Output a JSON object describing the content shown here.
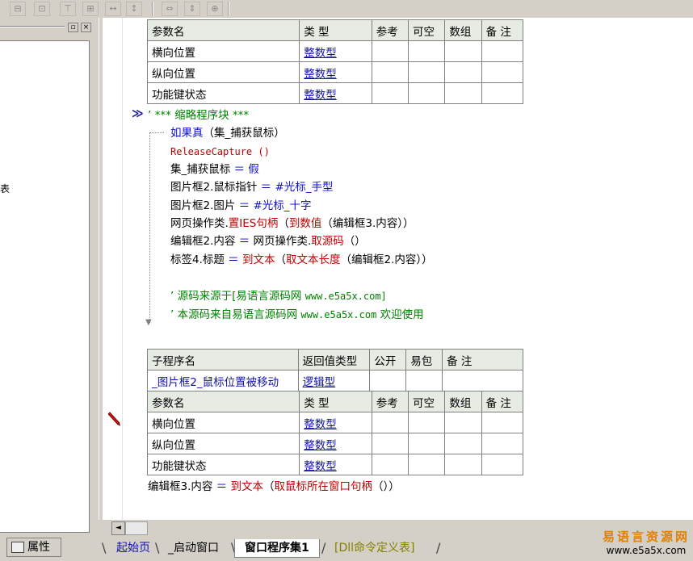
{
  "toolbar": {
    "buttons": [
      "align-left-icon",
      "align-center-icon",
      "align-top-icon",
      "align-middle-icon",
      "space-horizontal-icon",
      "space-vertical-icon",
      "same-width-icon",
      "same-height-icon",
      "same-size-icon"
    ]
  },
  "left_panel": {
    "fragment": "表",
    "min_btn": "▫",
    "close_btn": "×"
  },
  "table1": {
    "header": [
      "参数名",
      "类 型",
      "参考",
      "可空",
      "数组",
      "备 注"
    ],
    "rows": [
      {
        "name": "横向位置",
        "type": "整数型"
      },
      {
        "name": "纵向位置",
        "type": "整数型"
      },
      {
        "name": "功能键状态",
        "type": "整数型"
      }
    ]
  },
  "code": {
    "block_comment": "’ *** 缩略程序块 ***",
    "line1_kw": "如果真",
    "line1_rest": "（集_捕获鼠标）",
    "line2": "ReleaseCapture ()",
    "line3_a": "集_捕获鼠标",
    "line3_b": " ＝ ",
    "line3_c": "假",
    "line4_a": "图片框2.鼠标指针",
    "line4_b": " ＝ ",
    "line4_c": "#光标_手型",
    "line5_a": "图片框2.图片",
    "line5_b": " ＝ ",
    "line5_c": "#光标_十字",
    "line6_a": "网页操作类.",
    "line6_b": "置IES句柄",
    "line6_c": "（",
    "line6_d": "到数值",
    "line6_e": "（编辑框3.内容））",
    "line7_a": "编辑框2.内容",
    "line7_b": " ＝ ",
    "line7_c": "网页操作类.",
    "line7_d": "取源码",
    "line7_e": "（）",
    "line8_a": "标签4.标题",
    "line8_b": " ＝ ",
    "line8_c": "到文本",
    "line8_d": "（",
    "line8_e": "取文本长度",
    "line8_f": "（编辑框2.内容））",
    "comment1_a": "’ 源码来源于[易语言源码网 ",
    "comment1_b": "www.e5a5x.com]",
    "comment2_a": "’ 本源码来自易语言源码网 ",
    "comment2_b": "www.e5a5x.com",
    "comment2_c": "  欢迎使用"
  },
  "table2": {
    "header": [
      "子程序名",
      "返回值类型",
      "公开",
      "易包",
      "备 注"
    ],
    "row": {
      "name": "_图片框2_鼠标位置被移动",
      "type": "逻辑型"
    }
  },
  "table3": {
    "header": [
      "参数名",
      "类 型",
      "参考",
      "可空",
      "数组",
      "备 注"
    ],
    "rows": [
      {
        "name": "横向位置",
        "type": "整数型"
      },
      {
        "name": "纵向位置",
        "type": "整数型"
      },
      {
        "name": "功能键状态",
        "type": "整数型"
      }
    ]
  },
  "code2": {
    "a": "编辑框3.内容",
    "b": " ＝ ",
    "c": "到文本",
    "d": "（",
    "e": "取鼠标所在窗口句柄",
    "f": "（））"
  },
  "scroll": {
    "left_arrow": "◄"
  },
  "tabs": [
    {
      "label": "起始页"
    },
    {
      "label": "_启动窗口"
    },
    {
      "label": "窗口程序集1"
    },
    {
      "label": "[Dll命令定义表]"
    }
  ],
  "attr_tab": {
    "label": "属性"
  },
  "logo": {
    "title": "易语言资源网",
    "url": "www.e5a5x.com"
  },
  "colors": {
    "keyword": "#1111cc",
    "function": "#c00000",
    "comment": "#008000",
    "type_link": "#1111aa",
    "header_bg": "#e6ece4"
  }
}
